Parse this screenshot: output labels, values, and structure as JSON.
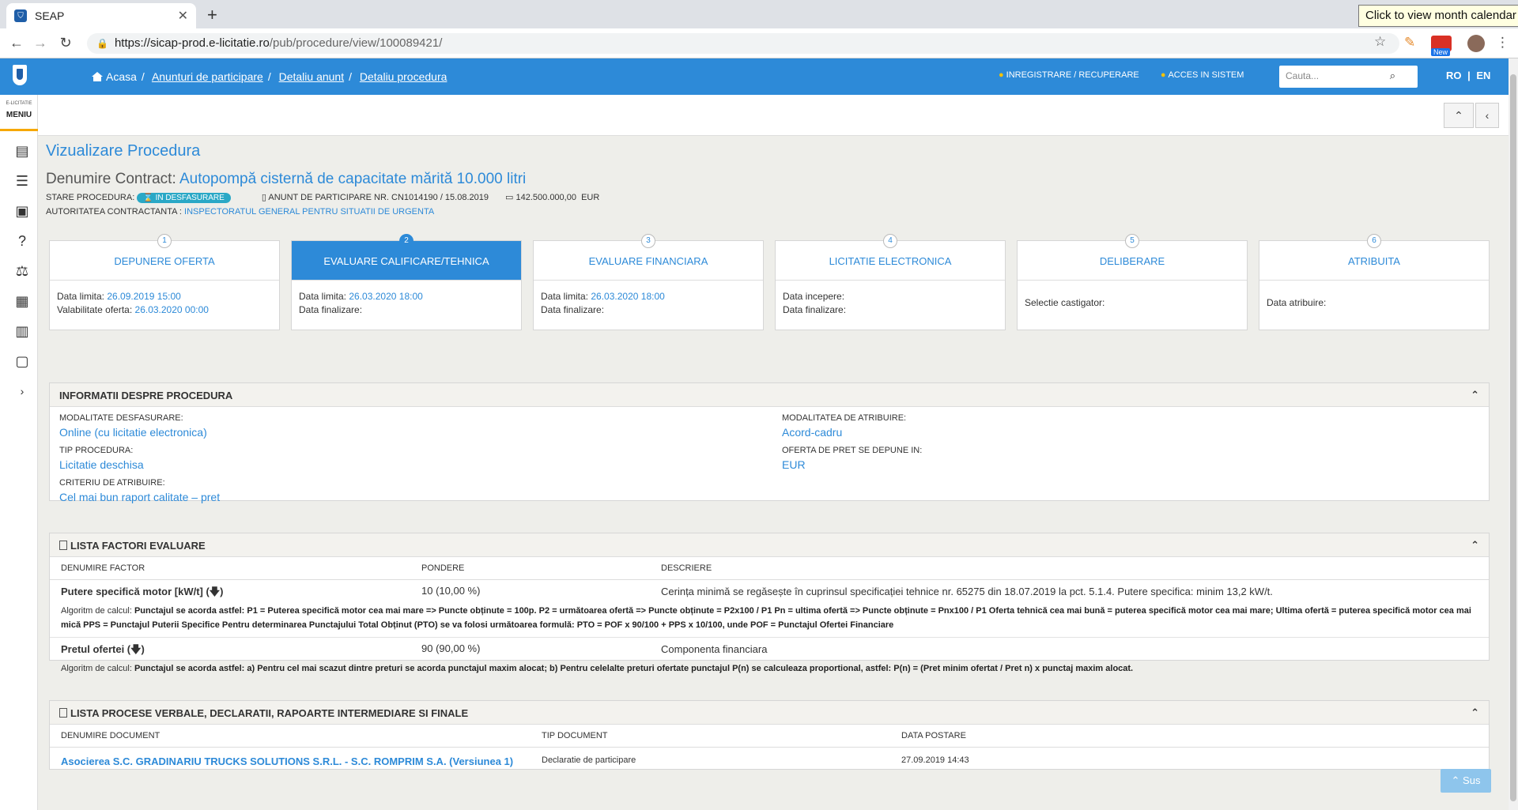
{
  "browser": {
    "tab_title": "SEAP",
    "tooltip": "Click to view month calendar",
    "url_host": "https://sicap-prod.e-licitatie.ro",
    "url_path": "/pub/procedure/view/100089421/",
    "ext_new_badge": "New"
  },
  "sidebar": {
    "brand_small": "E-LICITATIE",
    "menu_label": "MENIU",
    "expand_glyph": "›"
  },
  "topnav": {
    "breadcrumbs": [
      "Acasa",
      "Anunturi de participare",
      "Detaliu anunt",
      "Detaliu procedura"
    ],
    "register": "INREGISTRARE / RECUPERARE",
    "login": "ACCES IN SISTEM",
    "search_placeholder": "Cauta...",
    "lang_ro": "RO",
    "lang_sep": "|",
    "lang_en": "EN"
  },
  "page": {
    "title": "Vizualizare Procedura",
    "contract_label": "Denumire Contract:",
    "contract_value": "Autopompă cisternă de capacitate mărită 10.000 litri",
    "status_label": "STARE PROCEDURA:",
    "status_value": "IN DESFASURARE",
    "notice": "ANUNT DE PARTICIPARE NR. CN1014190 / 15.08.2019",
    "amount": "142.500.000,00",
    "currency": "EUR",
    "authority_label": "AUTORITATEA CONTRACTANTA :",
    "authority_value": "INSPECTORATUL GENERAL PENTRU SITUATII DE URGENTA"
  },
  "steps": [
    {
      "num": "1",
      "title": "DEPUNERE OFERTA",
      "l1": "Data limita:",
      "v1": "26.09.2019 15:00",
      "l2": "Valabilitate oferta:",
      "v2": "26.03.2020 00:00"
    },
    {
      "num": "2",
      "title": "EVALUARE CALIFICARE/TEHNICA",
      "l1": "Data limita:",
      "v1": "26.03.2020 18:00",
      "l2": "Data finalizare:",
      "v2": ""
    },
    {
      "num": "3",
      "title": "EVALUARE FINANCIARA",
      "l1": "Data limita:",
      "v1": "26.03.2020 18:00",
      "l2": "Data finalizare:",
      "v2": ""
    },
    {
      "num": "4",
      "title": "LICITATIE ELECTRONICA",
      "l1": "Data incepere:",
      "v1": "",
      "l2": "Data finalizare:",
      "v2": ""
    },
    {
      "num": "5",
      "title": "DELIBERARE",
      "l1": "Selectie castigator:",
      "v1": "",
      "l2": "",
      "v2": ""
    },
    {
      "num": "6",
      "title": "ATRIBUITA",
      "l1": "Data atribuire:",
      "v1": "",
      "l2": "",
      "v2": ""
    }
  ],
  "info": {
    "heading": "INFORMATII DESPRE PROCEDURA",
    "mod_desf_label": "MODALITATE DESFASURARE:",
    "mod_desf_value": "Online (cu licitatie electronica)",
    "tip_label": "TIP PROCEDURA:",
    "tip_value": "Licitatie deschisa",
    "crit_label": "CRITERIU DE ATRIBUIRE:",
    "crit_value": "Cel mai bun raport calitate – pret",
    "mod_atr_label": "MODALITATEA DE ATRIBUIRE:",
    "mod_atr_value": "Acord-cadru",
    "oferta_label": "OFERTA DE PRET SE DEPUNE IN:",
    "oferta_value": "EUR"
  },
  "factors": {
    "heading": "LISTA FACTORI EVALUARE",
    "col_name": "DENUMIRE FACTOR",
    "col_weight": "PONDERE",
    "col_desc": "DESCRIERE",
    "alg_label": "Algoritm de calcul:",
    "rows": [
      {
        "name": "Putere specifică motor [kW/t] (🡇)",
        "weight": "10 (10,00 %)",
        "desc": "Cerința minimă se regăsește în cuprinsul specificației tehnice nr. 65275 din 18.07.2019 la pct. 5.1.4. Putere specifica: minim 13,2 kW/t.",
        "alg": "Punctajul se acorda astfel: P1 = Puterea specifică motor cea mai mare => Puncte obținute = 100p. P2 = următoarea ofertă => Puncte obținute = P2x100 / P1 Pn = ultima ofertă => Puncte obținute = Pnx100 / P1 Oferta tehnică cea mai bună = puterea specifică motor cea mai mare; Ultima ofertă = puterea specifică motor cea mai mică PPS = Punctajul Puterii Specifice Pentru determinarea Punctajului Total Obținut (PTO) se va folosi următoarea formulă: PTO = POF x 90/100 + PPS x 10/100, unde POF = Punctajul Ofertei Financiare"
      },
      {
        "name": "Pretul ofertei (🡇)",
        "weight": "90 (90,00 %)",
        "desc": "Componenta financiara",
        "alg": "Punctajul se acorda astfel: a) Pentru cel mai scazut dintre preturi se acorda punctajul maxim alocat; b) Pentru celelalte preturi ofertate punctajul P(n) se calculeaza proportional, astfel: P(n) = (Pret minim ofertat / Pret n) x punctaj maxim alocat."
      }
    ]
  },
  "documents": {
    "heading": "LISTA PROCESE VERBALE, DECLARATII, RAPOARTE INTERMEDIARE SI FINALE",
    "col_name": "DENUMIRE DOCUMENT",
    "col_type": "TIP DOCUMENT",
    "col_date": "DATA POSTARE",
    "rows": [
      {
        "name": "Asocierea S.C. GRADINARIU TRUCKS SOLUTIONS S.R.L. - S.C. ROMPRIM S.A. (Versiunea 1)",
        "type": "Declaratie de participare",
        "date": "27.09.2019 14:43"
      }
    ]
  },
  "sus_label": "Sus",
  "colors": {
    "accent": "#2d8ad8",
    "badge": "#2aa8c6",
    "background": "#eeeeea"
  }
}
